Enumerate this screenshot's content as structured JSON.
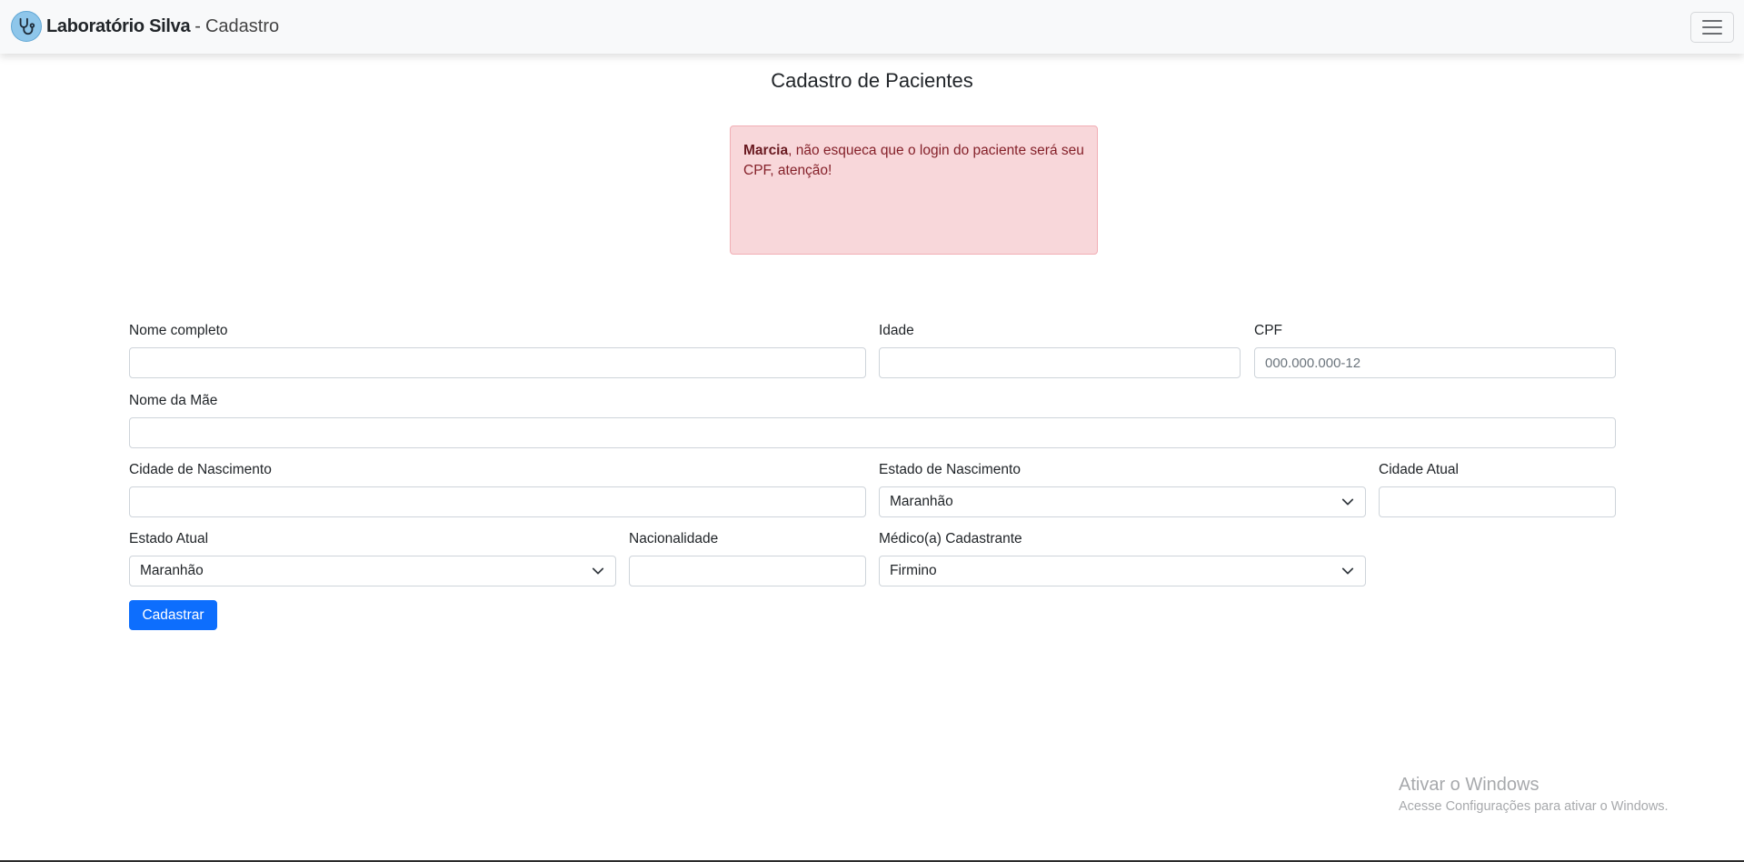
{
  "navbar": {
    "brand_name": "Laboratório Silva",
    "brand_separator": "-",
    "brand_section": "Cadastro",
    "logo_icon": "stethoscope-icon",
    "menu_icon": "hamburger-menu-icon"
  },
  "page": {
    "title": "Cadastro de Pacientes"
  },
  "alert": {
    "name": "Marcia",
    "message": ", não esqueca que o login do paciente será seu CPF, atenção!"
  },
  "form": {
    "nome_completo": {
      "label": "Nome completo",
      "value": ""
    },
    "idade": {
      "label": "Idade",
      "value": ""
    },
    "cpf": {
      "label": "CPF",
      "placeholder": "000.000.000-12",
      "value": ""
    },
    "nome_mae": {
      "label": "Nome da Mãe",
      "value": ""
    },
    "cidade_nascimento": {
      "label": "Cidade de Nascimento",
      "value": ""
    },
    "estado_nascimento": {
      "label": "Estado de Nascimento",
      "selected": "Maranhão"
    },
    "cidade_atual": {
      "label": "Cidade Atual",
      "value": ""
    },
    "estado_atual": {
      "label": "Estado Atual",
      "selected": "Maranhão"
    },
    "nacionalidade": {
      "label": "Nacionalidade",
      "value": ""
    },
    "medico": {
      "label": "Médico(a) Cadastrante",
      "selected": "Firmino"
    },
    "submit_label": "Cadastrar"
  },
  "watermark": {
    "title": "Ativar o Windows",
    "subtitle": "Acesse Configurações para ativar o Windows."
  },
  "colors": {
    "primary": "#0d6efd",
    "alert_bg": "#f8d7da",
    "alert_text": "#842029",
    "navbar_bg": "#f8f9fa"
  }
}
